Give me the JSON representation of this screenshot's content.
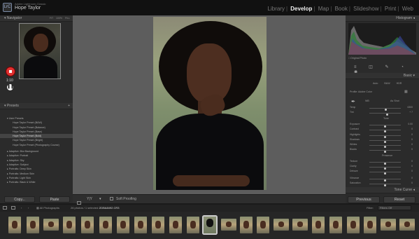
{
  "app": {
    "title": "Adobe Lightroom Classic",
    "user": "Hope Taylor",
    "logo": "LrC",
    "modules": [
      "Library",
      "Develop",
      "Map",
      "Book",
      "Slideshow",
      "Print",
      "Web"
    ],
    "active_module": "Develop"
  },
  "left_panel": {
    "navigator_label": "Navigator",
    "zoom_options": [
      "FIT",
      "100%",
      "FILL"
    ],
    "recording_timer": "1:10",
    "presets_label": "Presets",
    "user_presets": "User Presets",
    "preset_items": [
      "Hope Taylor Preset (B&W)",
      "Hope Taylor Preset (Balance)",
      "Hope Taylor Preset (Base)",
      "Hope Taylor Preset (Bold)",
      "Hope Taylor Preset (Bright)",
      "Hope Taylor Preset (Photography Course)"
    ],
    "preset_groups": [
      "Adaptive: Blur Background",
      "Adaptive: Portrait",
      "Adaptive: Sky",
      "Adaptive: Subject",
      "Portraits: Deep Skin",
      "Portraits: Medium Skin",
      "Portraits: Light Skin",
      "Portraits: Black & White"
    ],
    "copy_button": "Copy...",
    "paste_button": "Paste"
  },
  "toolbar": {
    "soft_proofing": "Soft Proofing"
  },
  "right_panel": {
    "histogram_label": "Histogram",
    "original_photo": "Original Photo",
    "basic_label": "Basic",
    "treatment": [
      "Auto",
      "B&W",
      "HDR"
    ],
    "profile_label": "Profile",
    "profile_value": "Adobe Color",
    "wb_label": "WB",
    "wb_value": "As Shot",
    "tone_label": "Tone",
    "presence_label": "Presence",
    "sliders_wb": [
      {
        "label": "Temp",
        "value": "6300"
      },
      {
        "label": "Tint",
        "value": "+ 7"
      }
    ],
    "sliders_tone": [
      {
        "label": "Exposure",
        "value": "0.00"
      },
      {
        "label": "Contrast",
        "value": "0"
      },
      {
        "label": "Highlights",
        "value": "0"
      },
      {
        "label": "Shadows",
        "value": "0"
      },
      {
        "label": "Whites",
        "value": "0"
      },
      {
        "label": "Blacks",
        "value": "0"
      }
    ],
    "sliders_presence": [
      {
        "label": "Texture",
        "value": "0"
      },
      {
        "label": "Clarity",
        "value": "0"
      },
      {
        "label": "Dehaze",
        "value": "0"
      },
      {
        "label": "Vibrance",
        "value": "0"
      },
      {
        "label": "Saturation",
        "value": "0"
      }
    ],
    "tone_curve_label": "Tone Curve",
    "previous_button": "Previous",
    "reset_button": "Reset"
  },
  "filmbar": {
    "source": "All Photographs",
    "count": "26 photos / 1 selected /",
    "filename": "2DBA8492.CR3",
    "filter_label": "Filter:",
    "filter_value": "Filters Off"
  }
}
